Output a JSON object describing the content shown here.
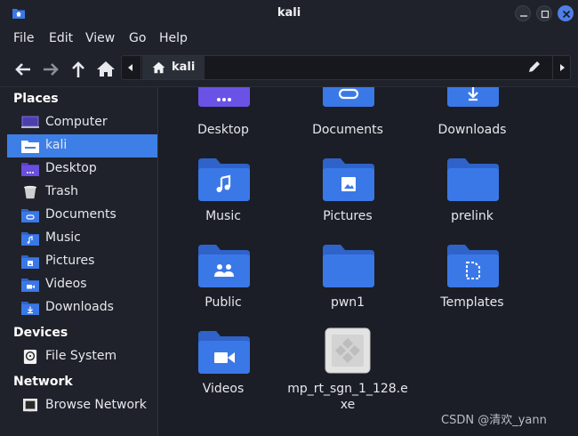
{
  "window": {
    "title": "kali"
  },
  "menu": [
    "File",
    "Edit",
    "View",
    "Go",
    "Help"
  ],
  "pathbar": {
    "crumb": "kali"
  },
  "sidebar": {
    "sections": [
      {
        "title": "Places",
        "items": [
          {
            "label": "Computer",
            "icon": "computer-icon"
          },
          {
            "label": "kali",
            "icon": "home-folder-icon",
            "active": true
          },
          {
            "label": "Desktop",
            "icon": "desktop-folder-icon"
          },
          {
            "label": "Trash",
            "icon": "trash-icon"
          },
          {
            "label": "Documents",
            "icon": "documents-folder-icon"
          },
          {
            "label": "Music",
            "icon": "music-folder-icon"
          },
          {
            "label": "Pictures",
            "icon": "pictures-folder-icon"
          },
          {
            "label": "Videos",
            "icon": "videos-folder-icon"
          },
          {
            "label": "Downloads",
            "icon": "downloads-folder-icon"
          }
        ]
      },
      {
        "title": "Devices",
        "items": [
          {
            "label": "File System",
            "icon": "drive-icon"
          }
        ]
      },
      {
        "title": "Network",
        "items": [
          {
            "label": "Browse Network",
            "icon": "network-icon"
          }
        ]
      }
    ]
  },
  "files": [
    {
      "label": "Desktop",
      "icon": "desktop-folder-icon"
    },
    {
      "label": "Documents",
      "icon": "documents-folder-icon"
    },
    {
      "label": "Downloads",
      "icon": "downloads-folder-icon"
    },
    {
      "label": "Music",
      "icon": "music-folder-icon"
    },
    {
      "label": "Pictures",
      "icon": "pictures-folder-icon"
    },
    {
      "label": "prelink",
      "icon": "folder-icon"
    },
    {
      "label": "Public",
      "icon": "public-folder-icon"
    },
    {
      "label": "pwn1",
      "icon": "folder-icon"
    },
    {
      "label": "Templates",
      "icon": "templates-folder-icon"
    },
    {
      "label": "Videos",
      "icon": "videos-folder-icon"
    },
    {
      "label": "mp_rt_sgn_1_128.exe",
      "label_lines": [
        "mp_rt_sgn_1_128.e",
        "xe"
      ],
      "icon": "executable-file-icon"
    }
  ],
  "watermark": "CSDN @清欢_yann",
  "colors": {
    "accent": "#3d7fe6",
    "folder": "#3b78e7",
    "folder_tab": "#2f63c9",
    "background": "#1b1e26",
    "sidebar": "#1f222a"
  }
}
